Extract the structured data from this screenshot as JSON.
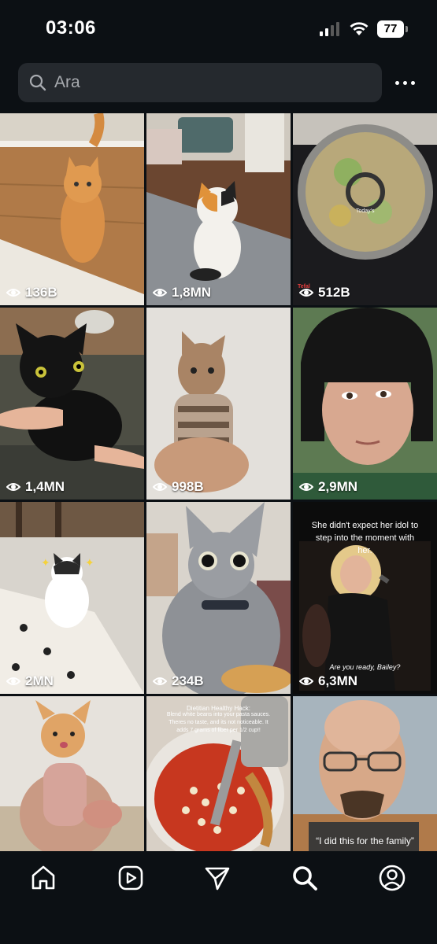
{
  "status": {
    "time": "03:06",
    "battery": "77"
  },
  "search": {
    "placeholder": "Ara"
  },
  "tiles": [
    {
      "views": "136B"
    },
    {
      "views": "1,8MN"
    },
    {
      "views": "512B",
      "brand": "Tefal",
      "overlay": "Today's"
    },
    {
      "views": "1,4MN"
    },
    {
      "views": "998B"
    },
    {
      "views": "2,9MN"
    },
    {
      "views": "2MN"
    },
    {
      "views": "234B"
    },
    {
      "views": "6,3MN",
      "caption": "She didn't expect her idol to step into the moment with her.",
      "subcaption": "Are you ready, Bailey?"
    },
    {},
    {
      "title": "Dietitian Healthy Hack:",
      "caption": "Blend white beans into your pasta sauces. Theres no taste, and its not noticeable. It adds 7 grams of fiber per 1/2 cup!!"
    },
    {
      "caption": "“I did this for the family”"
    }
  ],
  "nav": [
    "home-icon",
    "reels-icon",
    "direct-icon",
    "search-icon",
    "profile-icon"
  ],
  "colors": {
    "background": "#0c1014",
    "search_box": "#25292e"
  }
}
